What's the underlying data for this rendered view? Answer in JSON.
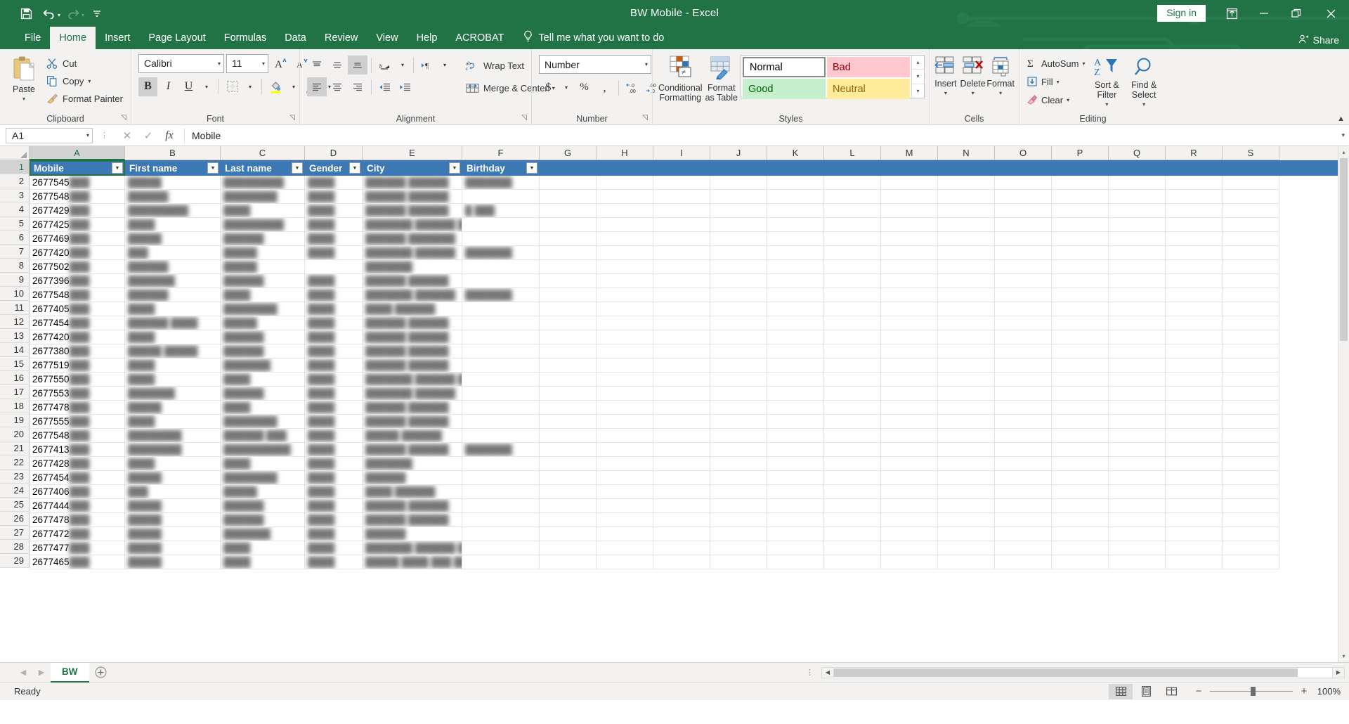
{
  "window": {
    "title": "BW Mobile  -  Excel",
    "signin_label": "Sign in",
    "ribbon_display_icon": "ribbon-display-options-icon",
    "minimize_icon": "minimize-icon",
    "restore_icon": "restore-icon",
    "close_icon": "close-icon"
  },
  "qat": {
    "save_icon": "save-icon",
    "undo_icon": "undo-icon",
    "redo_icon": "redo-icon",
    "customize_icon": "customize-quick-access-toolbar-icon"
  },
  "tabs": [
    {
      "label": "File",
      "active": false
    },
    {
      "label": "Home",
      "active": true
    },
    {
      "label": "Insert",
      "active": false
    },
    {
      "label": "Page Layout",
      "active": false
    },
    {
      "label": "Formulas",
      "active": false
    },
    {
      "label": "Data",
      "active": false
    },
    {
      "label": "Review",
      "active": false
    },
    {
      "label": "View",
      "active": false
    },
    {
      "label": "Help",
      "active": false
    },
    {
      "label": "ACROBAT",
      "active": false
    }
  ],
  "tellme": {
    "label": "Tell me what you want to do",
    "icon": "lightbulb-icon"
  },
  "share": {
    "label": "Share",
    "icon": "share-person-icon"
  },
  "ribbon": {
    "clipboard": {
      "group_label": "Clipboard",
      "paste_label": "Paste",
      "cut_label": "Cut",
      "copy_label": "Copy",
      "format_painter_label": "Format Painter"
    },
    "font": {
      "group_label": "Font",
      "font_name": "Calibri",
      "font_size": "11",
      "grow_label": "A",
      "shrink_label": "A",
      "bold_label": "B",
      "italic_label": "I",
      "underline_label": "U"
    },
    "alignment": {
      "group_label": "Alignment",
      "wrap_text_label": "Wrap Text",
      "merge_center_label": "Merge & Center"
    },
    "number": {
      "group_label": "Number",
      "format_value": "Number",
      "currency_label": "$",
      "percent_label": "%",
      "comma_label": ","
    },
    "styles": {
      "group_label": "Styles",
      "conditional_formatting_label": "Conditional Formatting",
      "format_as_table_label": "Format as Table",
      "gallery": [
        {
          "name": "Normal",
          "bg": "#ffffff",
          "fg": "#000000"
        },
        {
          "name": "Bad",
          "bg": "#ffc7ce",
          "fg": "#9c0006"
        },
        {
          "name": "Good",
          "bg": "#c6efce",
          "fg": "#006100"
        },
        {
          "name": "Neutral",
          "bg": "#ffeb9c",
          "fg": "#9c6500"
        }
      ]
    },
    "cells": {
      "group_label": "Cells",
      "insert_label": "Insert",
      "delete_label": "Delete",
      "format_label": "Format"
    },
    "editing": {
      "group_label": "Editing",
      "autosum_label": "AutoSum",
      "fill_label": "Fill",
      "clear_label": "Clear",
      "sort_filter_label": "Sort & Filter",
      "find_select_label": "Find & Select"
    }
  },
  "formula_bar": {
    "name_box": "A1",
    "cancel_icon": "cancel-icon",
    "enter_icon": "confirm-checkmark-icon",
    "function_icon": "insert-function-icon",
    "value": "Mobile"
  },
  "grid": {
    "columns": [
      "A",
      "B",
      "C",
      "D",
      "E",
      "F",
      "G",
      "H",
      "I",
      "J",
      "K",
      "L",
      "M",
      "N",
      "O",
      "P",
      "Q",
      "R",
      "S"
    ],
    "selected_column": "A",
    "selected_row": 1,
    "table_headers": [
      "Mobile",
      "First name",
      "Last name",
      "Gender",
      "City",
      "Birthday"
    ],
    "header_bg": "#3b78b4",
    "selection_border": "#217346",
    "rows": [
      {
        "n": 2,
        "mobile": "2677545",
        "first": "█████",
        "last": "█████████",
        "gender": "████",
        "city": "██████ ██████",
        "birthday": "███████"
      },
      {
        "n": 3,
        "mobile": "2677548",
        "first": "██████",
        "last": "████████",
        "gender": "████",
        "city": "██████ ██████",
        "birthday": ""
      },
      {
        "n": 4,
        "mobile": "2677429",
        "first": "█████████",
        "last": "████",
        "gender": "████",
        "city": "██████ ██████",
        "birthday": "█ ███"
      },
      {
        "n": 5,
        "mobile": "2677425",
        "first": "████",
        "last": "█████████",
        "gender": "████",
        "city": "███████ ██████ ███████",
        "birthday": ""
      },
      {
        "n": 6,
        "mobile": "2677469",
        "first": "█████",
        "last": "██████",
        "gender": "████",
        "city": "██████ ███████",
        "birthday": ""
      },
      {
        "n": 7,
        "mobile": "2677420",
        "first": "███",
        "last": "█████",
        "gender": "████",
        "city": "███████ ██████",
        "birthday": "███████"
      },
      {
        "n": 8,
        "mobile": "2677502",
        "first": "██████",
        "last": "█████",
        "gender": "",
        "city": "███████",
        "birthday": ""
      },
      {
        "n": 9,
        "mobile": "2677396",
        "first": "███████",
        "last": "██████",
        "gender": "████",
        "city": "██████ ██████",
        "birthday": ""
      },
      {
        "n": 10,
        "mobile": "2677548",
        "first": "██████",
        "last": "████",
        "gender": "████",
        "city": "███████ ██████",
        "birthday": "███████"
      },
      {
        "n": 11,
        "mobile": "2677405",
        "first": "████",
        "last": "████████",
        "gender": "████",
        "city": "████ ██████",
        "birthday": ""
      },
      {
        "n": 12,
        "mobile": "2677454",
        "first": "██████ ████",
        "last": "█████",
        "gender": "████",
        "city": "██████ ██████",
        "birthday": ""
      },
      {
        "n": 13,
        "mobile": "2677420",
        "first": "████",
        "last": "██████",
        "gender": "████",
        "city": "██████ ██████",
        "birthday": ""
      },
      {
        "n": 14,
        "mobile": "2677380",
        "first": "█████ █████",
        "last": "██████",
        "gender": "████",
        "city": "██████ ██████",
        "birthday": ""
      },
      {
        "n": 15,
        "mobile": "2677519",
        "first": "████",
        "last": "███████",
        "gender": "████",
        "city": "██████ ██████",
        "birthday": ""
      },
      {
        "n": 16,
        "mobile": "2677550",
        "first": "████",
        "last": "████",
        "gender": "████",
        "city": "███████ ██████ ███████",
        "birthday": ""
      },
      {
        "n": 17,
        "mobile": "2677553",
        "first": "███████",
        "last": "██████",
        "gender": "████",
        "city": "███████ ██████",
        "birthday": ""
      },
      {
        "n": 18,
        "mobile": "2677478",
        "first": "█████",
        "last": "████",
        "gender": "████",
        "city": "██████ ██████",
        "birthday": ""
      },
      {
        "n": 19,
        "mobile": "2677555",
        "first": "████",
        "last": "████████",
        "gender": "████",
        "city": "██████ ██████",
        "birthday": ""
      },
      {
        "n": 20,
        "mobile": "2677548",
        "first": "████████",
        "last": "██████ ███",
        "gender": "████",
        "city": "█████ ██████",
        "birthday": ""
      },
      {
        "n": 21,
        "mobile": "2677413",
        "first": "████████",
        "last": "██████████",
        "gender": "████",
        "city": "██████ ██████",
        "birthday": "███████"
      },
      {
        "n": 22,
        "mobile": "2677428",
        "first": "████",
        "last": "████",
        "gender": "████",
        "city": "███████",
        "birthday": ""
      },
      {
        "n": 23,
        "mobile": "2677454",
        "first": "█████",
        "last": "████████",
        "gender": "████",
        "city": "██████",
        "birthday": ""
      },
      {
        "n": 24,
        "mobile": "2677406",
        "first": "███",
        "last": "█████",
        "gender": "████",
        "city": "████ ██████",
        "birthday": ""
      },
      {
        "n": 25,
        "mobile": "2677444",
        "first": "█████",
        "last": "██████",
        "gender": "████",
        "city": "██████ ██████",
        "birthday": ""
      },
      {
        "n": 26,
        "mobile": "2677478",
        "first": "█████",
        "last": "██████",
        "gender": "████",
        "city": "██████ ██████",
        "birthday": ""
      },
      {
        "n": 27,
        "mobile": "2677472",
        "first": "█████",
        "last": "███████",
        "gender": "████",
        "city": "██████",
        "birthday": ""
      },
      {
        "n": 28,
        "mobile": "2677477",
        "first": "█████",
        "last": "████",
        "gender": "████",
        "city": "███████ ██████ █ ███",
        "birthday": ""
      },
      {
        "n": 29,
        "mobile": "2677465",
        "first": "█████",
        "last": "████",
        "gender": "████",
        "city": "█████ ████ ███ ██████",
        "birthday": ""
      }
    ]
  },
  "sheets": {
    "tabs": [
      {
        "label": "BW",
        "active": true
      }
    ],
    "add_label": "+",
    "prev_icon": "previous-sheet-icon",
    "next_icon": "next-sheet-icon"
  },
  "status": {
    "text": "Ready",
    "view_normal_icon": "normal-view-icon",
    "view_page_layout_icon": "page-layout-view-icon",
    "view_page_break_icon": "page-break-preview-icon",
    "zoom_out_label": "−",
    "zoom_in_label": "+",
    "zoom_level": "100%"
  }
}
